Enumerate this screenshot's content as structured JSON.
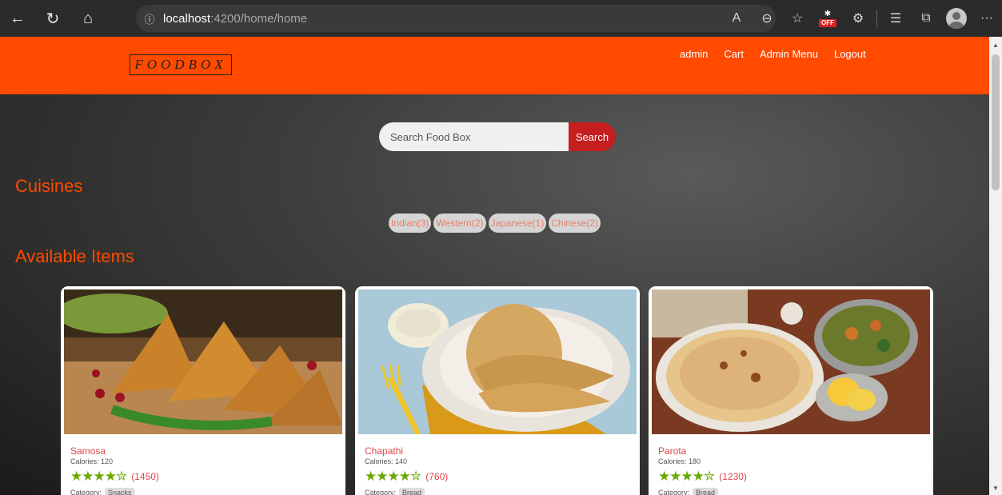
{
  "browser": {
    "address_host": "localhost",
    "address_path": ":4200/home/home",
    "off_badge": "OFF"
  },
  "header": {
    "logo": "FOODBOX",
    "nav": [
      "admin",
      "Cart",
      "Admin Menu",
      "Logout"
    ]
  },
  "search": {
    "placeholder": "Search Food Box",
    "button": "Search"
  },
  "cuisines": {
    "title": "Cuisines",
    "items": [
      "Indian(3)",
      "Western(2)",
      "Japanese(1)",
      "Chinese(2)"
    ]
  },
  "available": {
    "title": "Available Items",
    "items": [
      {
        "name": "Samosa",
        "calories": "Calories: 120",
        "stars": "★★★★✮",
        "rating_count": "(1450)",
        "category_label": "Category:",
        "category": "Snacks"
      },
      {
        "name": "Chapathi",
        "calories": "Calories: 140",
        "stars": "★★★★✮",
        "rating_count": "(760)",
        "category_label": "Category:",
        "category": "Bread"
      },
      {
        "name": "Parota",
        "calories": "Calories: 180",
        "stars": "★★★★✮",
        "rating_count": "(1230)",
        "category_label": "Category:",
        "category": "Bread"
      }
    ]
  },
  "colors": {
    "header_bg": "#ff4a00",
    "search_button": "#c41e1e",
    "star": "#6aa800",
    "item_name": "#e0454a"
  }
}
